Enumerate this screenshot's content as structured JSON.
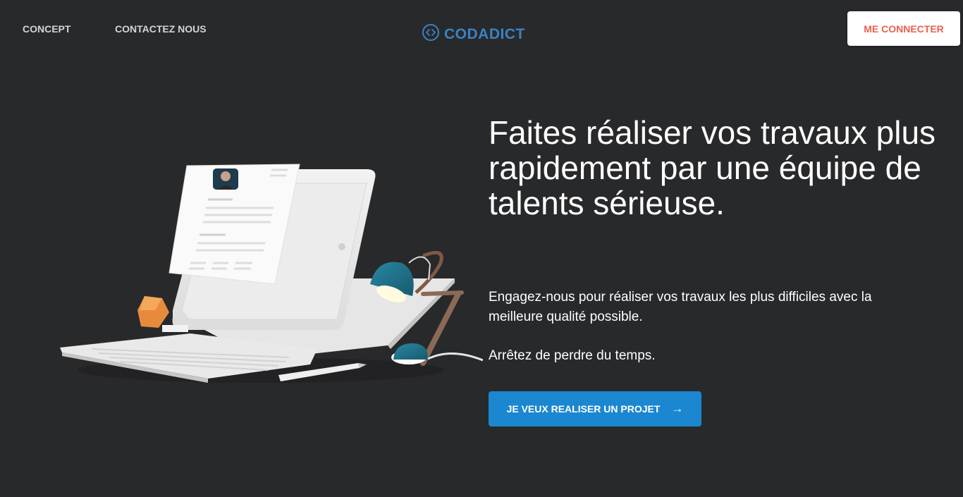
{
  "header": {
    "nav": [
      {
        "label": "CONCEPT"
      },
      {
        "label": "CONTACTEZ NOUS"
      }
    ],
    "brand": {
      "name": "CODADICT",
      "icon": "code-circle-icon",
      "color": "#3b82c4"
    },
    "login_label": "ME CONNECTER",
    "login_color": "#e8604f"
  },
  "hero": {
    "title": "Faites réaliser vos travaux plus rapidement par une équipe de talents sérieuse.",
    "text": "Engagez-nous pour réaliser vos travaux les plus difficiles avec la meilleure qualité possible.",
    "text2": "Arrêtez de perdre du temps.",
    "cta": {
      "label": "JE VEUX REALISER UN PROJET",
      "arrow": "→",
      "color": "#1a87d0"
    }
  },
  "colors": {
    "background": "#28292b",
    "lamp": "#1e6f88"
  }
}
